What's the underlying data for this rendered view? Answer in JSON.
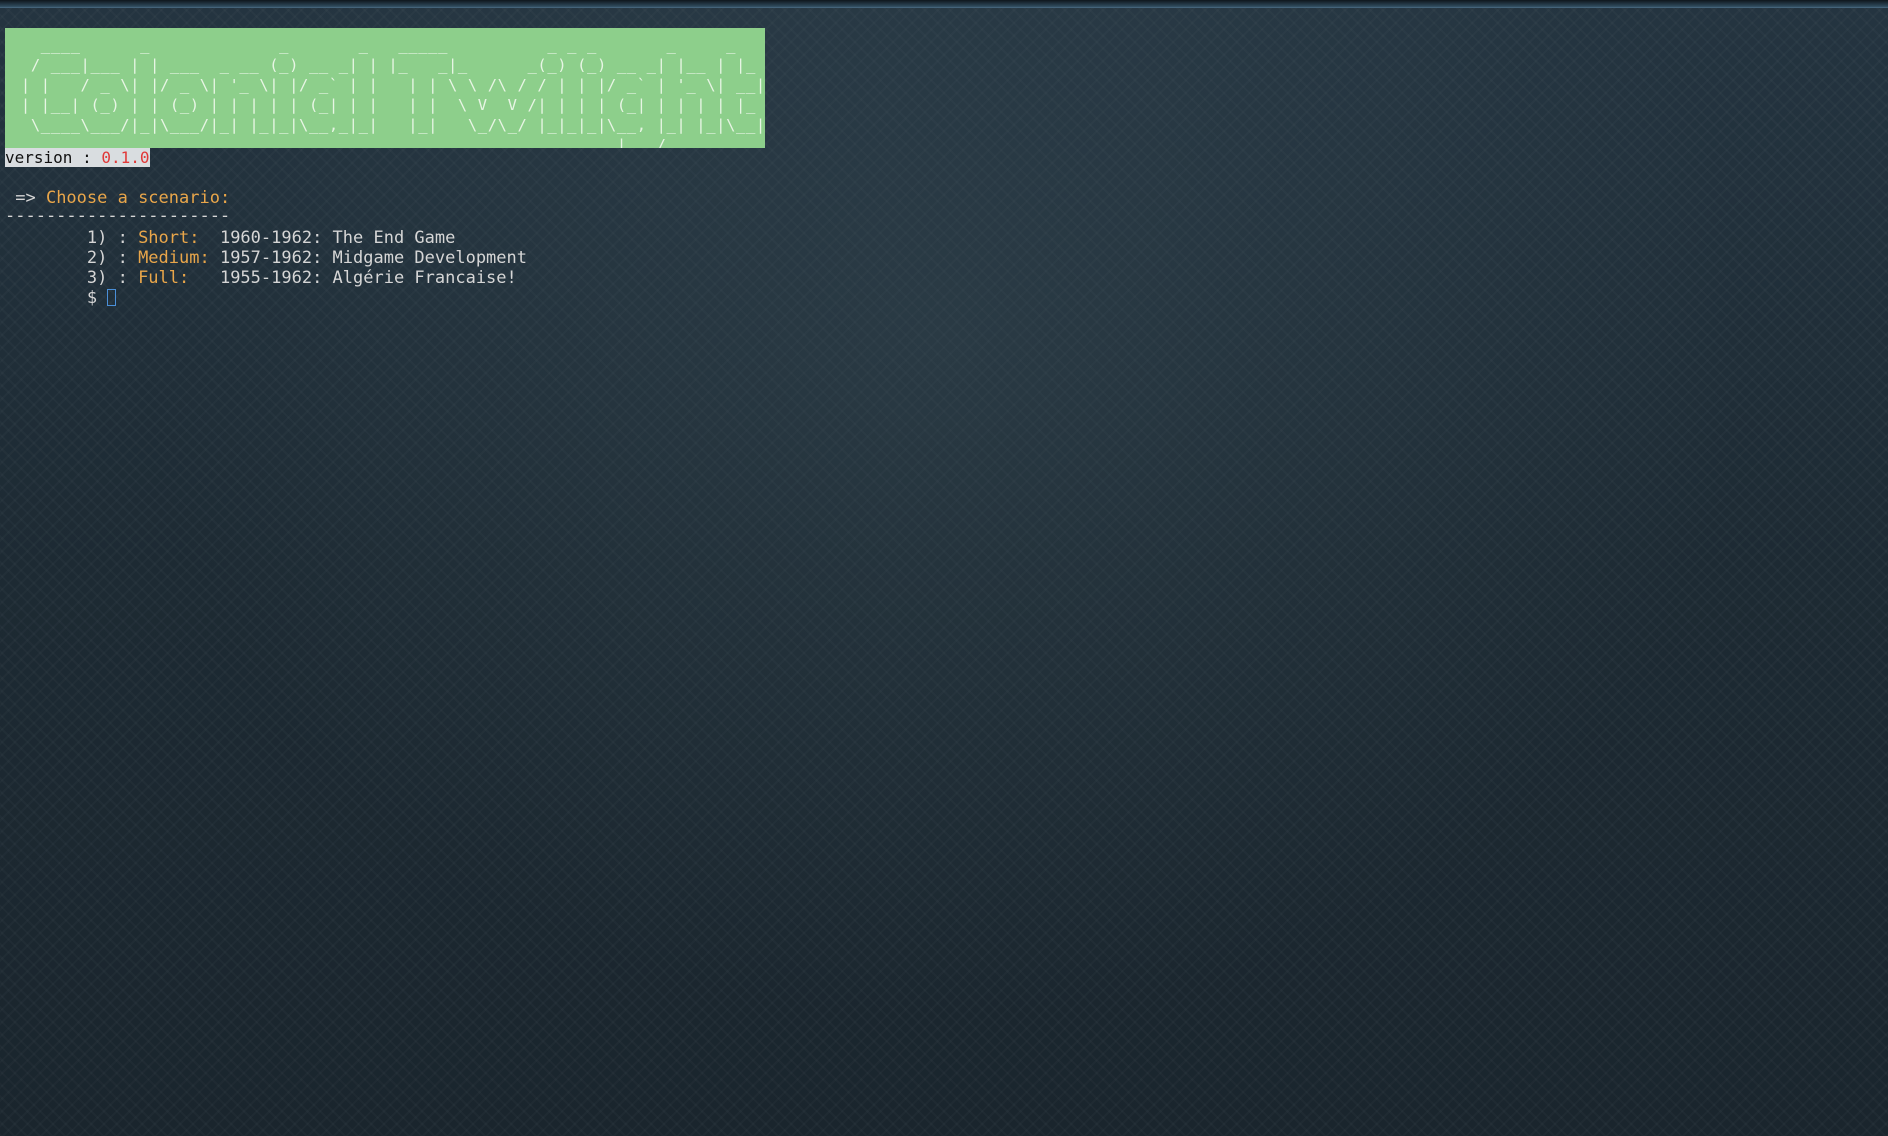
{
  "banner": {
    "ascii_lines": [
      "   ____      _             _       _   _____          _ _ _       _     _   ",
      "  / ___|___ | | ___  _ __ (_) __ _| | |_   _|_      _(_) (_) __ _| |__ | |_ ",
      " | |   / _ \\| |/ _ \\| '_ \\| |/ _` | |   | | \\ \\ /\\ / / | | |/ _` | '_ \\| __|",
      " | |__| (_) | | (_) | | | | | (_| | |   | |  \\ V  V /| | | | (_| | | | | |_ ",
      "  \\____\\___/|_|\\___/|_| |_|_|\\__,_|_|   |_|   \\_/\\_/ |_|_|_|\\__, |_| |_|\\__|",
      "                                                             |___/           "
    ],
    "background_color": "#8dcf8b"
  },
  "version": {
    "label": "version : ",
    "value": "0.1.0"
  },
  "prompt": {
    "arrow": " => ",
    "heading": "Choose a scenario:",
    "rule": "----------------------"
  },
  "options": [
    {
      "number": "        1) : ",
      "name": "Short:  ",
      "description": "1960-1962: The End Game"
    },
    {
      "number": "        2) : ",
      "name": "Medium: ",
      "description": "1957-1962: Midgame Development"
    },
    {
      "number": "        3) : ",
      "name": "Full:   ",
      "description": "1955-1962: Algérie Francaise!"
    }
  ],
  "shell": {
    "prompt": "        $ "
  },
  "colors": {
    "accent": "#e9a64a",
    "text": "#d6d6d6",
    "version_value": "#e13838",
    "cursor": "#4a8fd8"
  }
}
